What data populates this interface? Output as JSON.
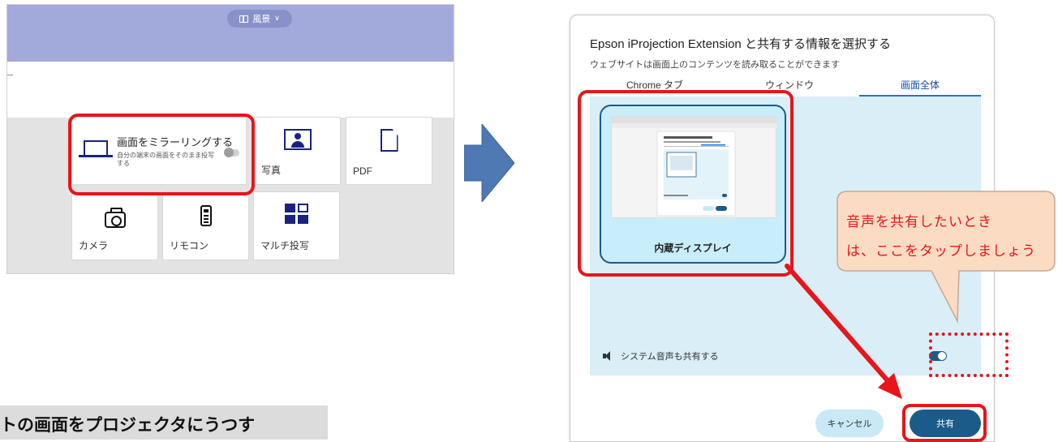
{
  "colors": {
    "highlight": "#e8151b",
    "accent": "#1b5b8a",
    "tile_icon": "#1a237e",
    "arrow_blue": "#4e79b3",
    "bubble_fill": "#fbdcc3"
  },
  "left_app": {
    "view_toggle_label": "風景",
    "tiles": {
      "mirror": {
        "title": "画面をミラーリングする",
        "description": "自分の端末の画面をそのまま投写する"
      },
      "photo": "写真",
      "pdf": "PDF",
      "camera": "カメラ",
      "remote": "リモコン",
      "multi": "マルチ投写"
    }
  },
  "caption": "トの画面をプロジェクタにうつす",
  "dialog": {
    "title": "Epson iProjection Extension と共有する情報を選択する",
    "subtitle": "ウェブサイトは画面上のコンテンツを読み取ることができます",
    "tabs": [
      "Chrome タブ",
      "ウィンドウ",
      "画面全体"
    ],
    "screen_card_label": "内蔵ディスプレイ",
    "audio_label": "システム音声も共有する",
    "cancel_label": "キャンセル",
    "share_label": "共有"
  },
  "callout": {
    "line1": "音声を共有したいとき",
    "line2": "は、ここをタップしましょう"
  }
}
